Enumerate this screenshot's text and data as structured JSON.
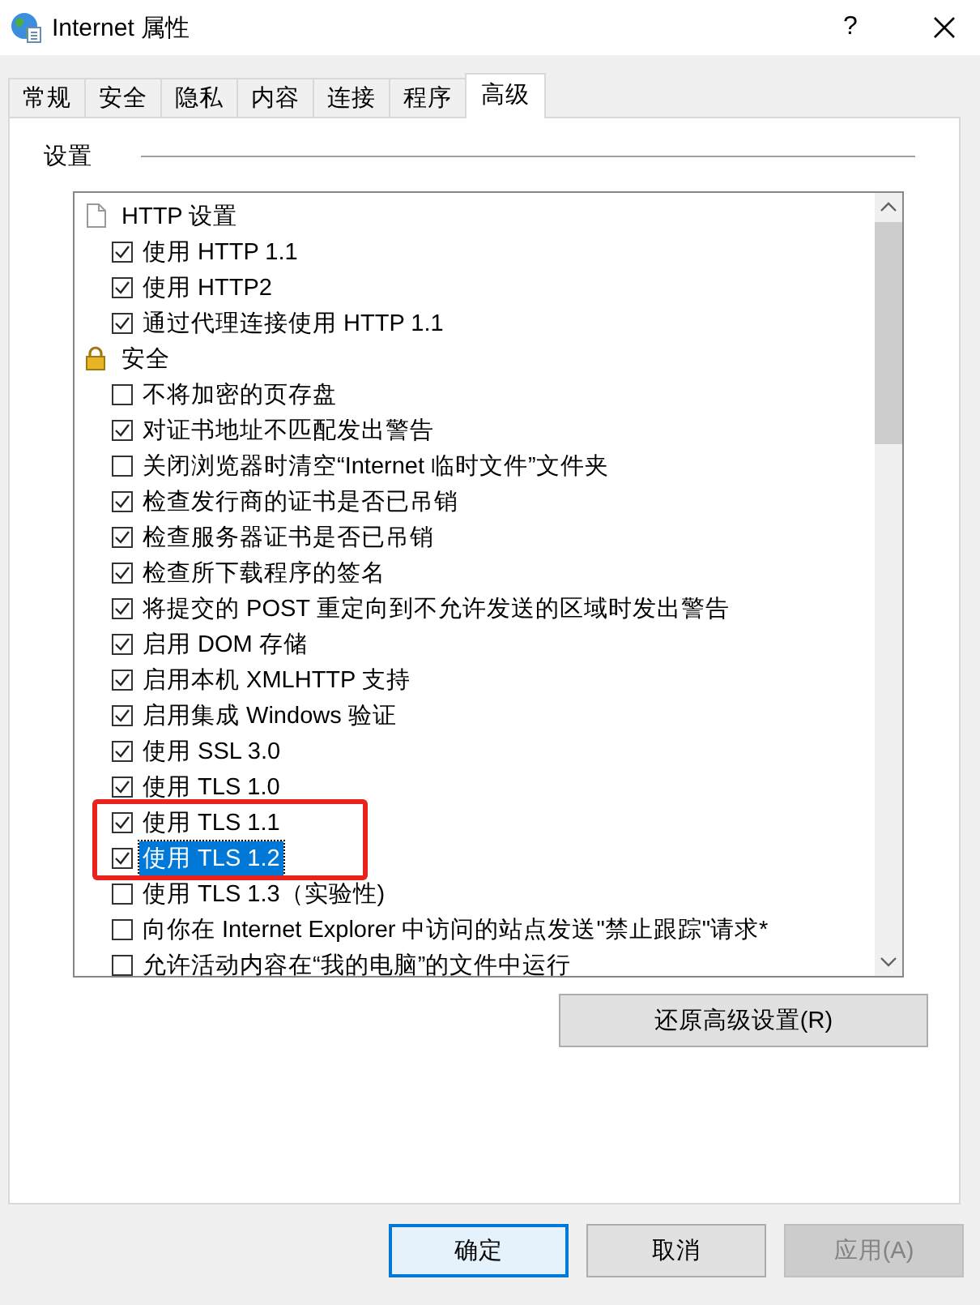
{
  "window": {
    "title": "Internet 属性",
    "help_button": "?"
  },
  "tabs": [
    {
      "label": "常规",
      "selected": false
    },
    {
      "label": "安全",
      "selected": false
    },
    {
      "label": "隐私",
      "selected": false
    },
    {
      "label": "内容",
      "selected": false
    },
    {
      "label": "连接",
      "selected": false
    },
    {
      "label": "程序",
      "selected": false
    },
    {
      "label": "高级",
      "selected": true
    }
  ],
  "settings": {
    "title": "设置",
    "groups": [
      {
        "label": "HTTP 设置",
        "children": [
          {
            "label": "使用 HTTP 1.1",
            "checked": true,
            "selected": false,
            "highlighted": false
          },
          {
            "label": "使用 HTTP2",
            "checked": true,
            "selected": false,
            "highlighted": false
          },
          {
            "label": "通过代理连接使用 HTTP 1.1",
            "checked": true,
            "selected": false,
            "highlighted": false
          }
        ]
      },
      {
        "label": "安全",
        "children": [
          {
            "label": "不将加密的页存盘",
            "checked": false,
            "selected": false,
            "highlighted": false
          },
          {
            "label": "对证书地址不匹配发出警告",
            "checked": true,
            "selected": false,
            "highlighted": false
          },
          {
            "label": "关闭浏览器时清空“Internet 临时文件”文件夹",
            "checked": false,
            "selected": false,
            "highlighted": false
          },
          {
            "label": "检查发行商的证书是否已吊销",
            "checked": true,
            "selected": false,
            "highlighted": false
          },
          {
            "label": "检查服务器证书是否已吊销",
            "checked": true,
            "selected": false,
            "highlighted": false
          },
          {
            "label": "检查所下载程序的签名",
            "checked": true,
            "selected": false,
            "highlighted": false
          },
          {
            "label": "将提交的 POST 重定向到不允许发送的区域时发出警告",
            "checked": true,
            "selected": false,
            "highlighted": false
          },
          {
            "label": "启用 DOM 存储",
            "checked": true,
            "selected": false,
            "highlighted": false
          },
          {
            "label": "启用本机 XMLHTTP 支持",
            "checked": true,
            "selected": false,
            "highlighted": false
          },
          {
            "label": "启用集成 Windows 验证",
            "checked": true,
            "selected": false,
            "highlighted": false
          },
          {
            "label": "使用 SSL 3.0",
            "checked": true,
            "selected": false,
            "highlighted": false
          },
          {
            "label": "使用 TLS 1.0",
            "checked": true,
            "selected": false,
            "highlighted": false
          },
          {
            "label": "使用 TLS 1.1",
            "checked": true,
            "selected": false,
            "highlighted": true
          },
          {
            "label": "使用 TLS 1.2",
            "checked": true,
            "selected": true,
            "highlighted": true
          },
          {
            "label": "使用 TLS 1.3（实验性)",
            "checked": false,
            "selected": false,
            "highlighted": false
          },
          {
            "label": "向你在 Internet Explorer 中访问的站点发送\"禁止跟踪\"请求*",
            "checked": false,
            "selected": false,
            "highlighted": false
          },
          {
            "label": "允许活动内容在“我的电脑”的文件中运行",
            "checked": false,
            "selected": false,
            "highlighted": false
          }
        ]
      }
    ]
  },
  "restore_button": "还原高级设置(R)",
  "buttons": [
    {
      "label": "确定",
      "kind": "default",
      "disabled": false
    },
    {
      "label": "取消",
      "kind": "normal",
      "disabled": false
    },
    {
      "label": "应用(A)",
      "kind": "normal",
      "disabled": true
    }
  ]
}
